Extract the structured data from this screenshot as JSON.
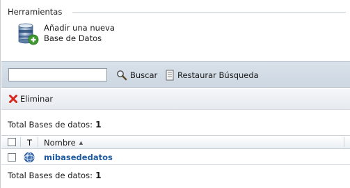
{
  "tools": {
    "legend": "Herramientas",
    "add_db_line1": "Añadir una nueva",
    "add_db_line2": "Base de Datos"
  },
  "search": {
    "value": "",
    "placeholder": "",
    "search_label": "Buscar",
    "restore_label": "Restaurar Búsqueda"
  },
  "actions": {
    "delete_label": "Eliminar"
  },
  "totals": {
    "label": "Total Bases de datos:",
    "count": "1"
  },
  "table": {
    "col_type": "T",
    "col_name": "Nombre",
    "sort_indicator": "▲",
    "rows": [
      {
        "name": "mibasededatos",
        "icon": "database-type-icon"
      }
    ]
  },
  "colors": {
    "link": "#1f5a9e",
    "toolbar_bg": "#d2dce6",
    "delete_icon": "#d9261c"
  }
}
